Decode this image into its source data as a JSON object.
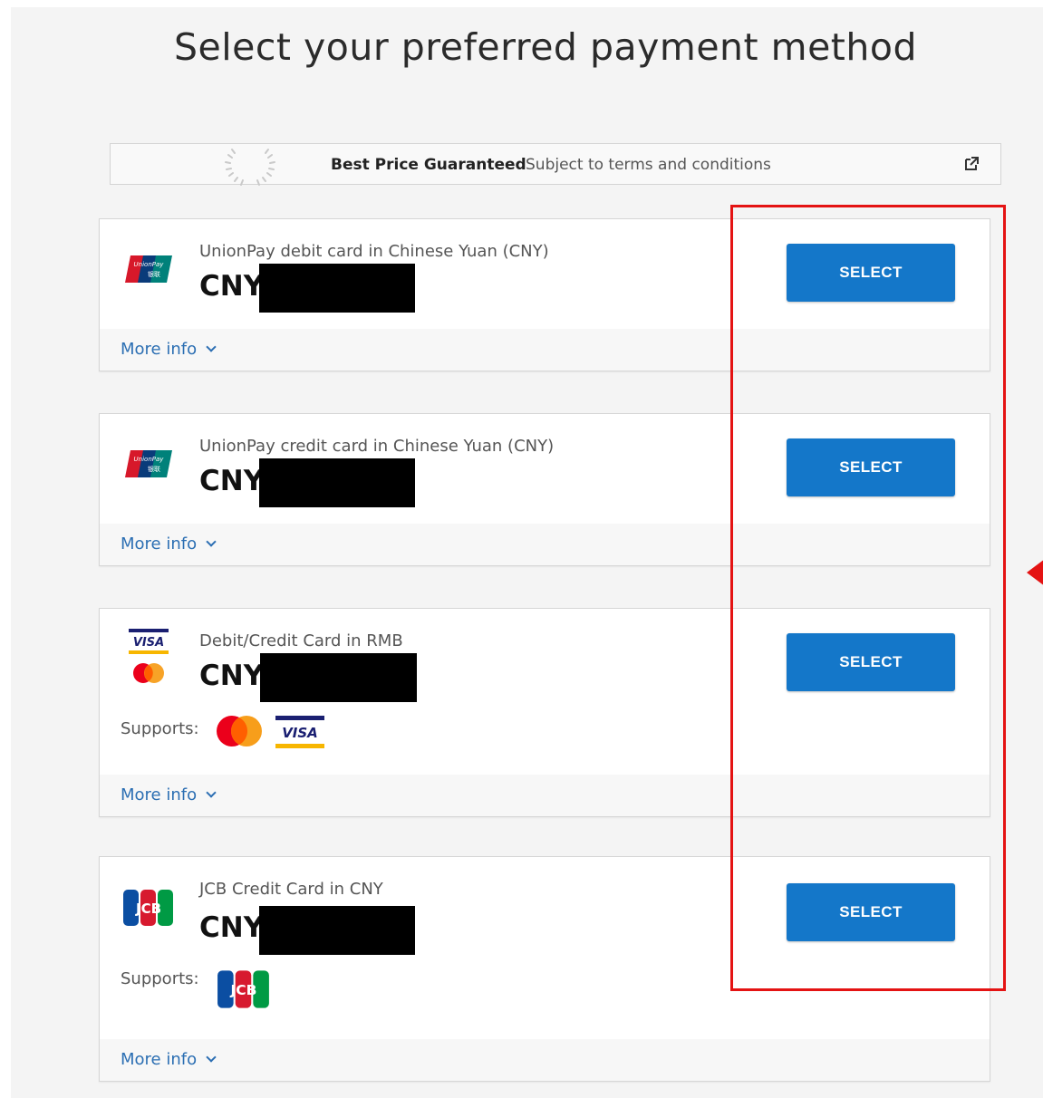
{
  "page": {
    "title": "Select your preferred payment method"
  },
  "banner": {
    "strong": "Best Price Guaranteed",
    "sub": "Subject to terms and conditions"
  },
  "cards": [
    {
      "label": "UnionPay debit card in Chinese Yuan (CNY)",
      "currency": "CNY",
      "button": "SELECT",
      "more": "More info"
    },
    {
      "label": "UnionPay credit card in Chinese Yuan (CNY)",
      "currency": "CNY",
      "button": "SELECT",
      "more": "More info"
    },
    {
      "label": "Debit/Credit Card in RMB",
      "currency": "CNY",
      "button": "SELECT",
      "more": "More info",
      "supports": "Supports:"
    },
    {
      "label": "JCB Credit Card in CNY",
      "currency": "CNY",
      "button": "SELECT",
      "more": "More info",
      "supports": "Supports:"
    }
  ],
  "logo_text": {
    "unionpay": "UnionPay",
    "unionpay_cn": "银联",
    "visa": "VISA",
    "jcb": "JCB"
  },
  "colors": {
    "accent": "#1477c9",
    "link": "#2c6fb3",
    "highlight": "#e41313"
  },
  "icons": [
    "laurel-icon",
    "external-link-icon",
    "chevron-down-icon",
    "unionpay-logo",
    "visa-logo",
    "mastercard-logo",
    "jcb-logo"
  ]
}
